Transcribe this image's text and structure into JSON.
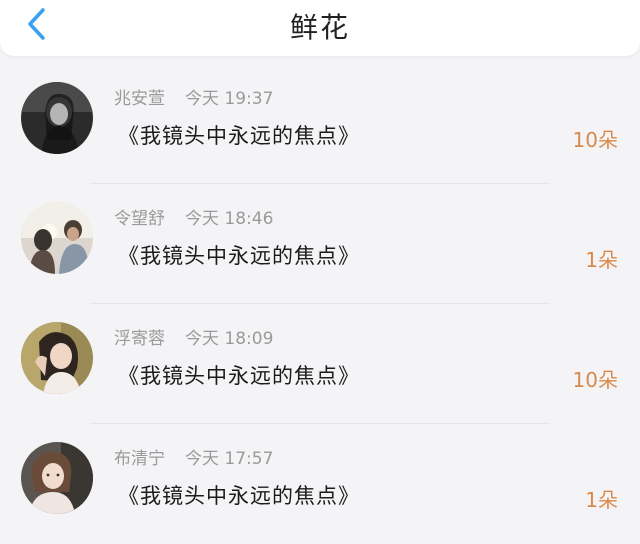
{
  "header": {
    "title": "鲜花",
    "back_icon": "chevron-left-icon",
    "accent_color": "#3aa0f0"
  },
  "gifts": [
    {
      "name": "兆安萱",
      "time": "今天 19:37",
      "message": "《我镜头中永远的焦点》",
      "amount": "10朵"
    },
    {
      "name": "令望舒",
      "time": "今天 18:46",
      "message": "《我镜头中永远的焦点》",
      "amount": "1朵"
    },
    {
      "name": "浮寄蓉",
      "time": "今天 18:09",
      "message": "《我镜头中永远的焦点》",
      "amount": "10朵"
    },
    {
      "name": "布清宁",
      "time": "今天 17:57",
      "message": "《我镜头中永远的焦点》",
      "amount": "1朵"
    }
  ],
  "colors": {
    "amount": "#d98a4a",
    "meta_text": "#9a9a9a"
  }
}
